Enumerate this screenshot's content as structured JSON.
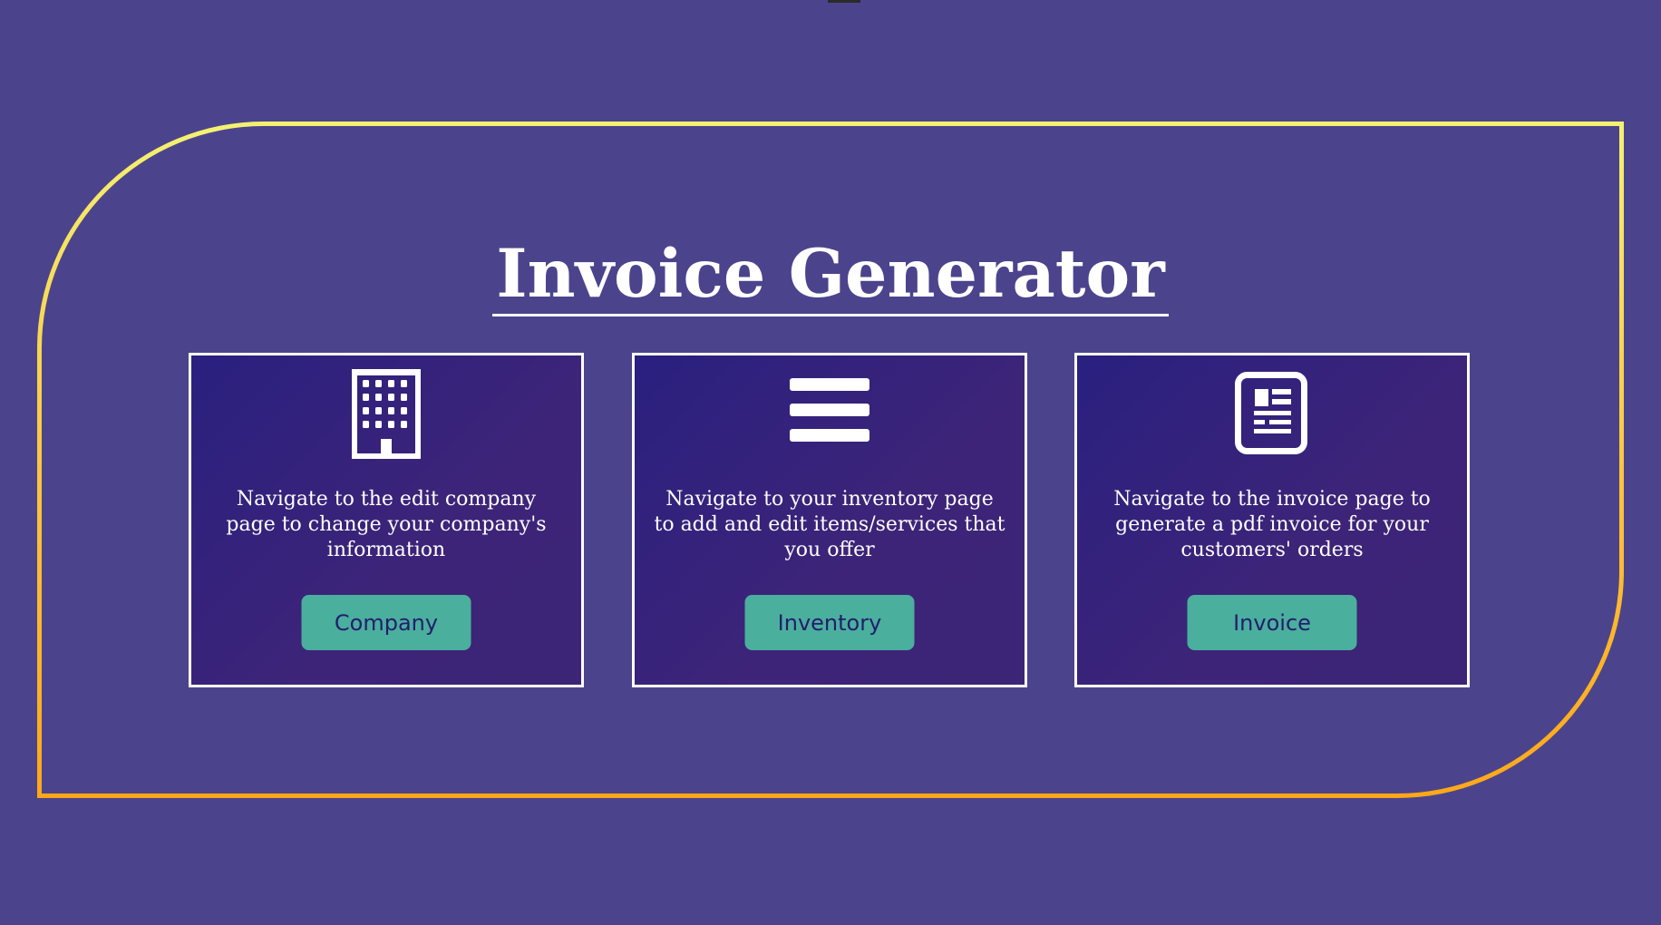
{
  "page": {
    "title": "Invoice Generator"
  },
  "colors": {
    "background": "#4b448c",
    "frame_top": "#f4f173",
    "frame_bottom": "#ffa718",
    "card_gradient_start": "#2a2080",
    "card_gradient_end": "#3c2476",
    "button": "#4aaf9d",
    "button_text": "#241d6e"
  },
  "cards": [
    {
      "icon": "building-icon",
      "description": "Navigate to the edit company page to change your company's information",
      "button_label": "Company"
    },
    {
      "icon": "list-icon",
      "description": "Navigate to your inventory page to add and edit items/services that you offer",
      "button_label": "Inventory"
    },
    {
      "icon": "document-icon",
      "description": "Navigate to the invoice page to generate a pdf invoice for your customers' orders",
      "button_label": "Invoice"
    }
  ]
}
